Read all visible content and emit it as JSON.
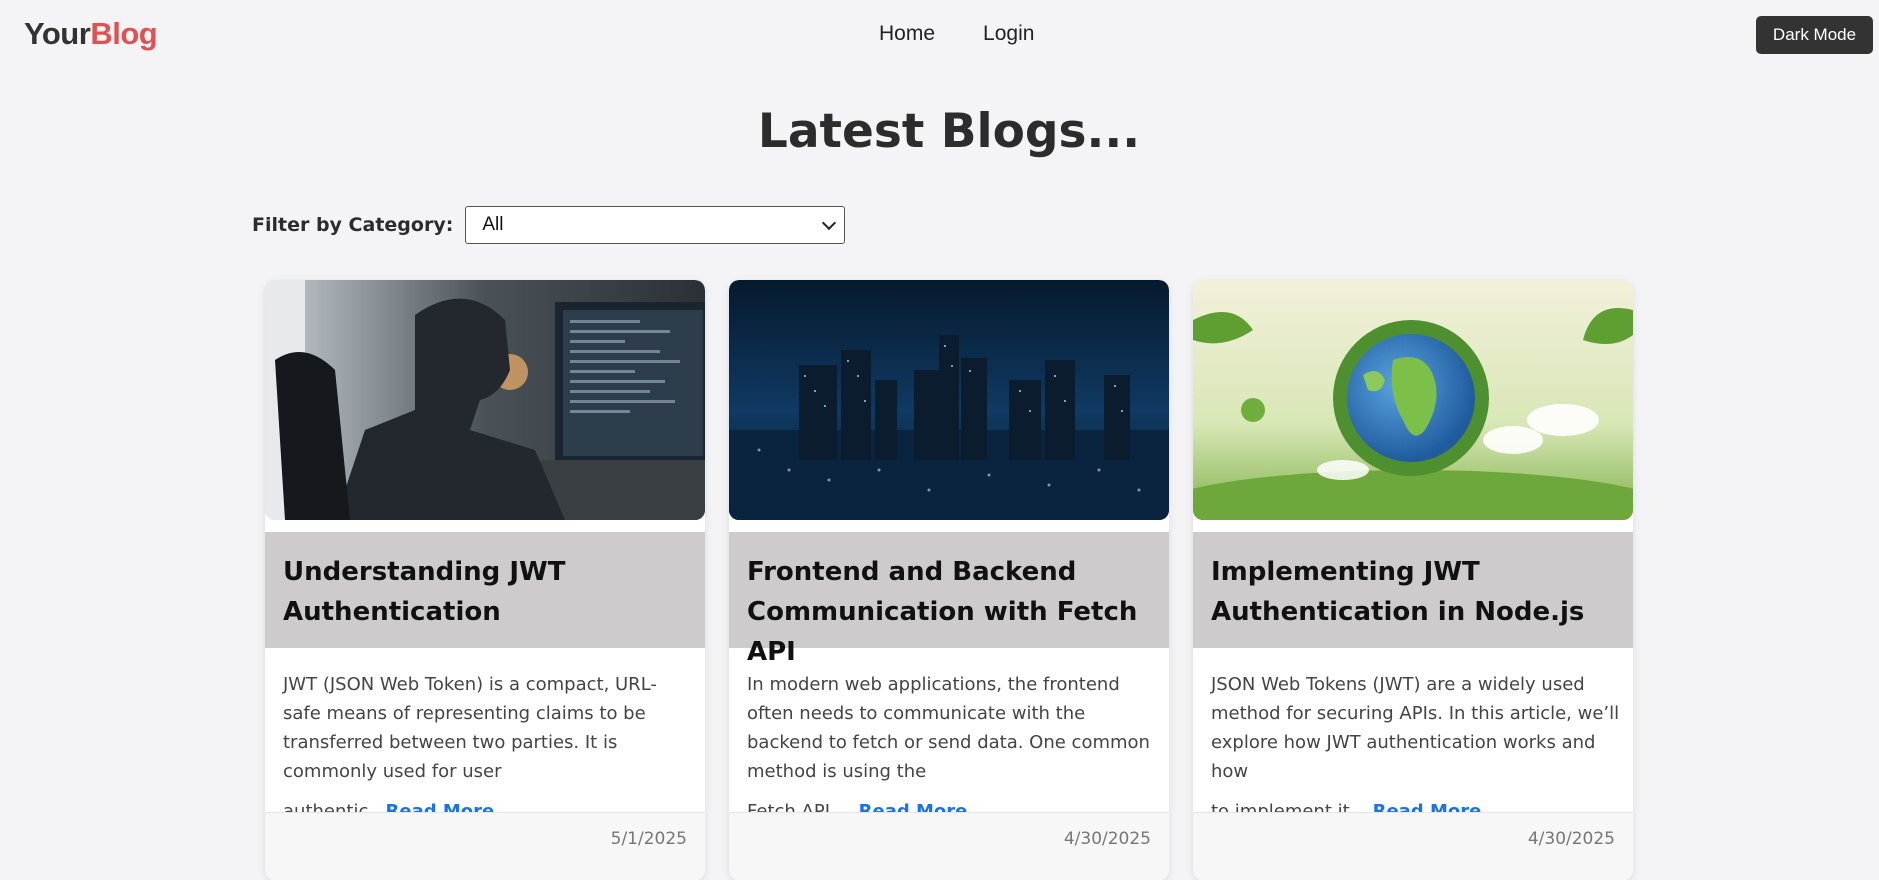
{
  "nav": {
    "logo_part1": "Your",
    "logo_part2": "Blog",
    "links": [
      "Home",
      "Login"
    ],
    "dark_mode_label": "Dark Mode"
  },
  "page": {
    "heading": "Latest Blogs...",
    "filter_label": "Filter by Category:",
    "filter_value": "All"
  },
  "posts": [
    {
      "image": "person-coding-at-computer",
      "title": "Understanding JWT Authentication",
      "excerpt_start": "JWT (JSON Web Token) is a compact, URL-safe means of representing claims to be transferred between two parties. It is commonly used for user",
      "excerpt_end": "authentic...",
      "read_more": "Read More",
      "date": "5/1/2025"
    },
    {
      "image": "night-city-skyline",
      "title": "Frontend and Backend Communication with Fetch API",
      "excerpt_start": "In modern web applications, the frontend often needs to communicate with the backend to fetch or send data. One common method is using the",
      "excerpt_end": "Fetch API, ...",
      "read_more": "Read More",
      "date": "4/30/2025"
    },
    {
      "image": "green-earth-globe",
      "title": "Implementing JWT Authentication in Node.js",
      "excerpt_start": "JSON Web Tokens (JWT) are a widely used method for securing APIs. In this article, we’ll explore how JWT authentication works and how",
      "excerpt_end": "to implement it ...",
      "read_more": "Read More",
      "date": "4/30/2025"
    }
  ]
}
